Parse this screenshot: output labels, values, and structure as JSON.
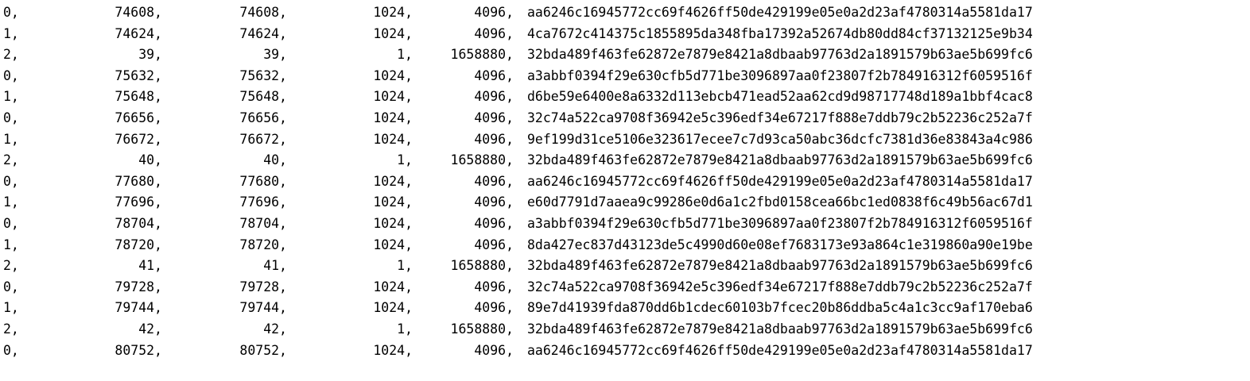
{
  "rows": [
    [
      "0,",
      "74608,",
      "74608,",
      "1024,",
      "4096,",
      "aa6246c16945772cc69f4626ff50de429199e05e0a2d23af4780314a5581da17"
    ],
    [
      "1,",
      "74624,",
      "74624,",
      "1024,",
      "4096,",
      "4ca7672c414375c1855895da348fba17392a52674db80dd84cf37132125e9b34"
    ],
    [
      "2,",
      "39,",
      "39,",
      "1,",
      "1658880,",
      "32bda489f463fe62872e7879e8421a8dbaab97763d2a1891579b63ae5b699fc6"
    ],
    [
      "0,",
      "75632,",
      "75632,",
      "1024,",
      "4096,",
      "a3abbf0394f29e630cfb5d771be3096897aa0f23807f2b784916312f6059516f"
    ],
    [
      "1,",
      "75648,",
      "75648,",
      "1024,",
      "4096,",
      "d6be59e6400e8a6332d113ebcb471ead52aa62cd9d98717748d189a1bbf4cac8"
    ],
    [
      "0,",
      "76656,",
      "76656,",
      "1024,",
      "4096,",
      "32c74a522ca9708f36942e5c396edf34e67217f888e7ddb79c2b52236c252a7f"
    ],
    [
      "1,",
      "76672,",
      "76672,",
      "1024,",
      "4096,",
      "9ef199d31ce5106e323617ecee7c7d93ca50abc36dcfc7381d36e83843a4c986"
    ],
    [
      "2,",
      "40,",
      "40,",
      "1,",
      "1658880,",
      "32bda489f463fe62872e7879e8421a8dbaab97763d2a1891579b63ae5b699fc6"
    ],
    [
      "0,",
      "77680,",
      "77680,",
      "1024,",
      "4096,",
      "aa6246c16945772cc69f4626ff50de429199e05e0a2d23af4780314a5581da17"
    ],
    [
      "1,",
      "77696,",
      "77696,",
      "1024,",
      "4096,",
      "e60d7791d7aaea9c99286e0d6a1c2fbd0158cea66bc1ed0838f6c49b56ac67d1"
    ],
    [
      "0,",
      "78704,",
      "78704,",
      "1024,",
      "4096,",
      "a3abbf0394f29e630cfb5d771be3096897aa0f23807f2b784916312f6059516f"
    ],
    [
      "1,",
      "78720,",
      "78720,",
      "1024,",
      "4096,",
      "8da427ec837d43123de5c4990d60e08ef7683173e93a864c1e319860a90e19be"
    ],
    [
      "2,",
      "41,",
      "41,",
      "1,",
      "1658880,",
      "32bda489f463fe62872e7879e8421a8dbaab97763d2a1891579b63ae5b699fc6"
    ],
    [
      "0,",
      "79728,",
      "79728,",
      "1024,",
      "4096,",
      "32c74a522ca9708f36942e5c396edf34e67217f888e7ddb79c2b52236c252a7f"
    ],
    [
      "1,",
      "79744,",
      "79744,",
      "1024,",
      "4096,",
      "89e7d41939fda870dd6b1cdec60103b7fcec20b86ddba5c4a1c3cc9af170eba6"
    ],
    [
      "2,",
      "42,",
      "42,",
      "1,",
      "1658880,",
      "32bda489f463fe62872e7879e8421a8dbaab97763d2a1891579b63ae5b699fc6"
    ],
    [
      "0,",
      "80752,",
      "80752,",
      "1024,",
      "4096,",
      "aa6246c16945772cc69f4626ff50de429199e05e0a2d23af4780314a5581da17"
    ]
  ]
}
